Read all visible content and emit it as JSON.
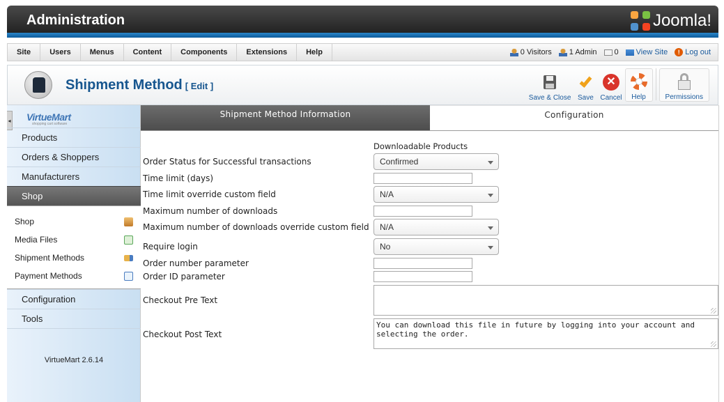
{
  "header": {
    "title": "Administration",
    "brand": "Joomla!"
  },
  "menu": {
    "items": [
      "Site",
      "Users",
      "Menus",
      "Content",
      "Components",
      "Extensions",
      "Help"
    ],
    "status": {
      "visitors": "0 Visitors",
      "admin": "1 Admin",
      "messages": "0",
      "view_site": "View Site",
      "logout": "Log out"
    }
  },
  "toolbar": {
    "title": "Shipment Method",
    "title_suffix": "[ Edit ]",
    "buttons": {
      "save_close": "Save & Close",
      "save": "Save",
      "cancel": "Cancel",
      "help": "Help",
      "permissions": "Permissions"
    },
    "colors": {
      "title": "#17568f",
      "save_check": "#f0a21b",
      "cancel_red": "#d9342b"
    }
  },
  "sidebar": {
    "logo": "VirtueMart",
    "logo_sub": "shopping cart software",
    "items": [
      "Products",
      "Orders & Shoppers",
      "Manufacturers",
      "Shop"
    ],
    "active": "Shop",
    "subitems": [
      {
        "label": "Shop",
        "icon": "shop-icon"
      },
      {
        "label": "Media Files",
        "icon": "media-files-icon"
      },
      {
        "label": "Shipment Methods",
        "icon": "shipment-truck-icon"
      },
      {
        "label": "Payment Methods",
        "icon": "payment-methods-icon"
      }
    ],
    "bottom_items": [
      "Configuration",
      "Tools"
    ],
    "version": "VirtueMart 2.6.14"
  },
  "tabs": {
    "info": "Shipment Method Information",
    "config": "Configuration",
    "active": "info"
  },
  "form": {
    "section": "Downloadable Products",
    "order_status": {
      "label": "Order Status for Successful transactions",
      "value": "Confirmed"
    },
    "time_limit": {
      "label": "Time limit (days)",
      "value": ""
    },
    "time_limit_override": {
      "label": "Time limit override custom field",
      "value": "N/A"
    },
    "max_downloads": {
      "label": "Maximum number of downloads",
      "value": ""
    },
    "max_downloads_override": {
      "label": "Maximum number of downloads override custom field",
      "value": "N/A"
    },
    "require_login": {
      "label": "Require login",
      "value": "No"
    },
    "order_number_param": {
      "label": "Order number parameter",
      "value": ""
    },
    "order_id_param": {
      "label": "Order ID parameter",
      "value": ""
    },
    "checkout_pre_text": {
      "label": "Checkout Pre Text",
      "value": ""
    },
    "checkout_post_text": {
      "label": "Checkout Post Text",
      "value": "You can download this file in future by logging into your account and selecting the order."
    }
  }
}
